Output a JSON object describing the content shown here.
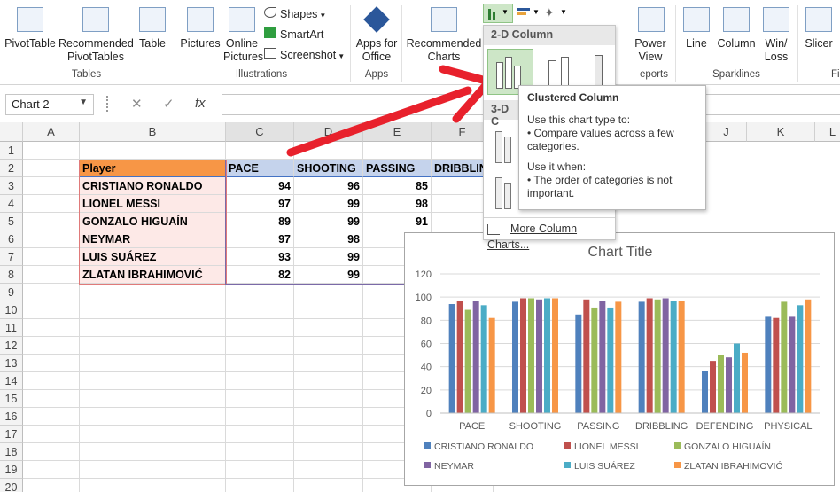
{
  "ribbon": {
    "items": [
      {
        "id": "pivottable",
        "label": "PivotTable"
      },
      {
        "id": "recpivot",
        "label": "Recommended\nPivotTables"
      },
      {
        "id": "table",
        "label": "Table"
      },
      {
        "id": "pictures",
        "label": "Pictures"
      },
      {
        "id": "onlinepictures",
        "label": "Online\nPictures"
      },
      {
        "id": "shapes",
        "label": "Shapes"
      },
      {
        "id": "smartart",
        "label": "SmartArt"
      },
      {
        "id": "screenshot",
        "label": "Screenshot"
      },
      {
        "id": "appsforoffice",
        "label": "Apps for\nOffice"
      },
      {
        "id": "recommended_charts",
        "label": "Recommended\nCharts"
      },
      {
        "id": "powerview",
        "label": "Power\nView"
      },
      {
        "id": "line",
        "label": "Line"
      },
      {
        "id": "column",
        "label": "Column"
      },
      {
        "id": "winloss",
        "label": "Win/\nLoss"
      },
      {
        "id": "slicer",
        "label": "Slicer"
      },
      {
        "id": "fil",
        "label": "Fil"
      }
    ],
    "groups": {
      "tables": "Tables",
      "illustrations": "Illustrations",
      "apps": "Apps",
      "reports": "eports",
      "sparklines": "Sparklines"
    }
  },
  "formula_bar": {
    "namebox": "Chart 2",
    "fx": "fx"
  },
  "columns": [
    "A",
    "B",
    "C",
    "D",
    "E",
    "F",
    "J",
    "K",
    "L"
  ],
  "rows": [
    "1",
    "2",
    "3",
    "4",
    "5",
    "6",
    "7",
    "8",
    "9",
    "10",
    "11",
    "12",
    "13",
    "14",
    "15",
    "16",
    "17",
    "18",
    "19",
    "20"
  ],
  "table": {
    "headers": [
      "Player",
      "PACE",
      "SHOOTING",
      "PASSING",
      "DRIBBLIN"
    ],
    "rows": [
      {
        "player": "CRISTIANO RONALDO",
        "pace": "94",
        "shooting": "96",
        "passing": "85"
      },
      {
        "player": "LIONEL MESSI",
        "pace": "97",
        "shooting": "99",
        "passing": "98"
      },
      {
        "player": "GONZALO HIGUAÍN",
        "pace": "89",
        "shooting": "99",
        "passing": "91"
      },
      {
        "player": "NEYMAR",
        "pace": "97",
        "shooting": "98",
        "passing": ""
      },
      {
        "player": "LUIS SUÁREZ",
        "pace": "93",
        "shooting": "99",
        "passing": ""
      },
      {
        "player": "ZLATAN IBRAHIMOVIĆ",
        "pace": "82",
        "shooting": "99",
        "passing": ""
      }
    ]
  },
  "dropdown": {
    "section_2d": "2-D Column",
    "section_3d": "3-D C",
    "more": "More Column Charts..."
  },
  "tooltip": {
    "title": "Clustered Column",
    "use_to": "Use this chart type to:",
    "bullet1": "• Compare values across a few categories.",
    "use_when": "Use it when:",
    "bullet2": "• The order of categories is not important."
  },
  "chart_data": {
    "type": "bar",
    "title": "Chart Title",
    "categories": [
      "PACE",
      "SHOOTING",
      "PASSING",
      "DRIBBLING",
      "DEFENDING",
      "PHYSICAL"
    ],
    "ylim": [
      0,
      120
    ],
    "yticks": [
      0,
      20,
      40,
      60,
      80,
      100,
      120
    ],
    "grid": true,
    "legend": "bottom",
    "series": [
      {
        "name": "CRISTIANO RONALDO",
        "color": "#4f81bd",
        "values": [
          94,
          96,
          85,
          96,
          36,
          83
        ]
      },
      {
        "name": "LIONEL MESSI",
        "color": "#c0504d",
        "values": [
          97,
          99,
          98,
          99,
          45,
          82
        ]
      },
      {
        "name": "GONZALO HIGUAÍN",
        "color": "#9bbb59",
        "values": [
          89,
          99,
          91,
          98,
          50,
          96
        ]
      },
      {
        "name": "NEYMAR",
        "color": "#8064a2",
        "values": [
          97,
          98,
          97,
          99,
          48,
          83
        ]
      },
      {
        "name": "LUIS SUÁREZ",
        "color": "#4bacc6",
        "values": [
          93,
          99,
          91,
          97,
          60,
          93
        ]
      },
      {
        "name": "ZLATAN IBRAHIMOVIĆ",
        "color": "#f79646",
        "values": [
          82,
          99,
          96,
          97,
          52,
          98
        ]
      }
    ]
  },
  "colors": {
    "header_fill": "#f79646",
    "header_blue": "#c5d3ec",
    "arrow": "#e8212c"
  }
}
